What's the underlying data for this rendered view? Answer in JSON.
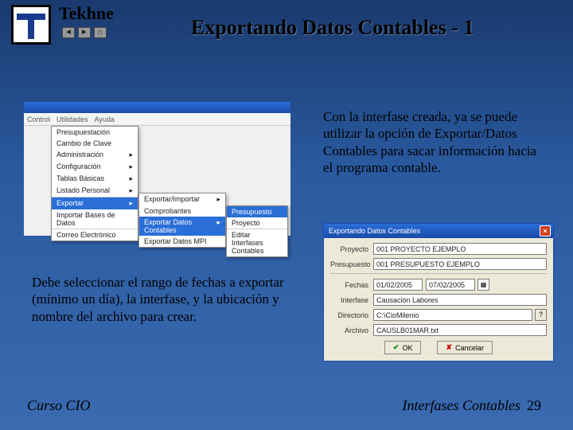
{
  "brand": "Tekhne",
  "title": "Exportando Datos Contables - 1",
  "para1": "Con la interfase creada, ya se puede utilizar la opción de Exportar/Datos Contables para sacar información hacia el programa contable.",
  "para2": "Debe seleccionar el rango de fechas a exportar (mínimo un día), la interfase, y la ubicación y nombre del archivo para crear.",
  "footer": {
    "left": "Curso CIO",
    "right": "Interfases Contables",
    "page": "29"
  },
  "menu1": {
    "bar": [
      "Control",
      "Utilidades",
      "Ayuda"
    ],
    "drop": [
      "Presupuestación",
      "Cambio de Clave",
      "Administración",
      "Configuración",
      "Tablas Básicas",
      "Listado Personal",
      "Exportar",
      "Importar Bases de Datos",
      "Correo Electrónico"
    ],
    "sub1": [
      "Exportar/Importar",
      "Comprobantes",
      "Exportar Datos Contables",
      "Exportar Datos MPI"
    ],
    "sub2": [
      "Presupuesto",
      "Proyecto",
      "Editar Interfases Contables"
    ]
  },
  "dialog": {
    "title": "Exportando Datos Contables",
    "labels": {
      "proyecto": "Proyecto",
      "presupuesto": "Presupuesto",
      "fechas": "Fechas",
      "interfase": "Interfase",
      "directorio": "Directorio",
      "archivo": "Archivo"
    },
    "values": {
      "proyecto": "001 PROYECTO EJEMPLO",
      "presupuesto": "001 PRESUPUESTO EJEMPLO",
      "fecha1": "01/02/2005",
      "fecha2": "07/02/2005",
      "interfase": "Causación Labores",
      "directorio": "C:\\CioMilenio",
      "archivo": "CAUSLB01MAR.txt"
    },
    "buttons": {
      "ok": "OK",
      "cancel": "Cancelar"
    }
  }
}
